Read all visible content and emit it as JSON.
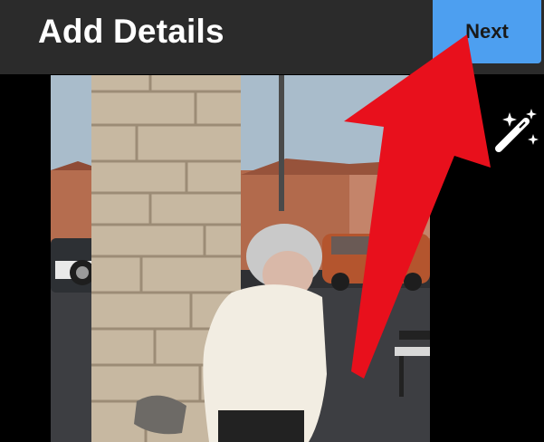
{
  "header": {
    "title": "Add Details",
    "next_label": "Next"
  },
  "icons": {
    "magic": "magic-wand-icon"
  },
  "colors": {
    "topbar": "#2b2b2b",
    "next_button": "#4d9ff0",
    "annotation_arrow": "#e8101c"
  }
}
